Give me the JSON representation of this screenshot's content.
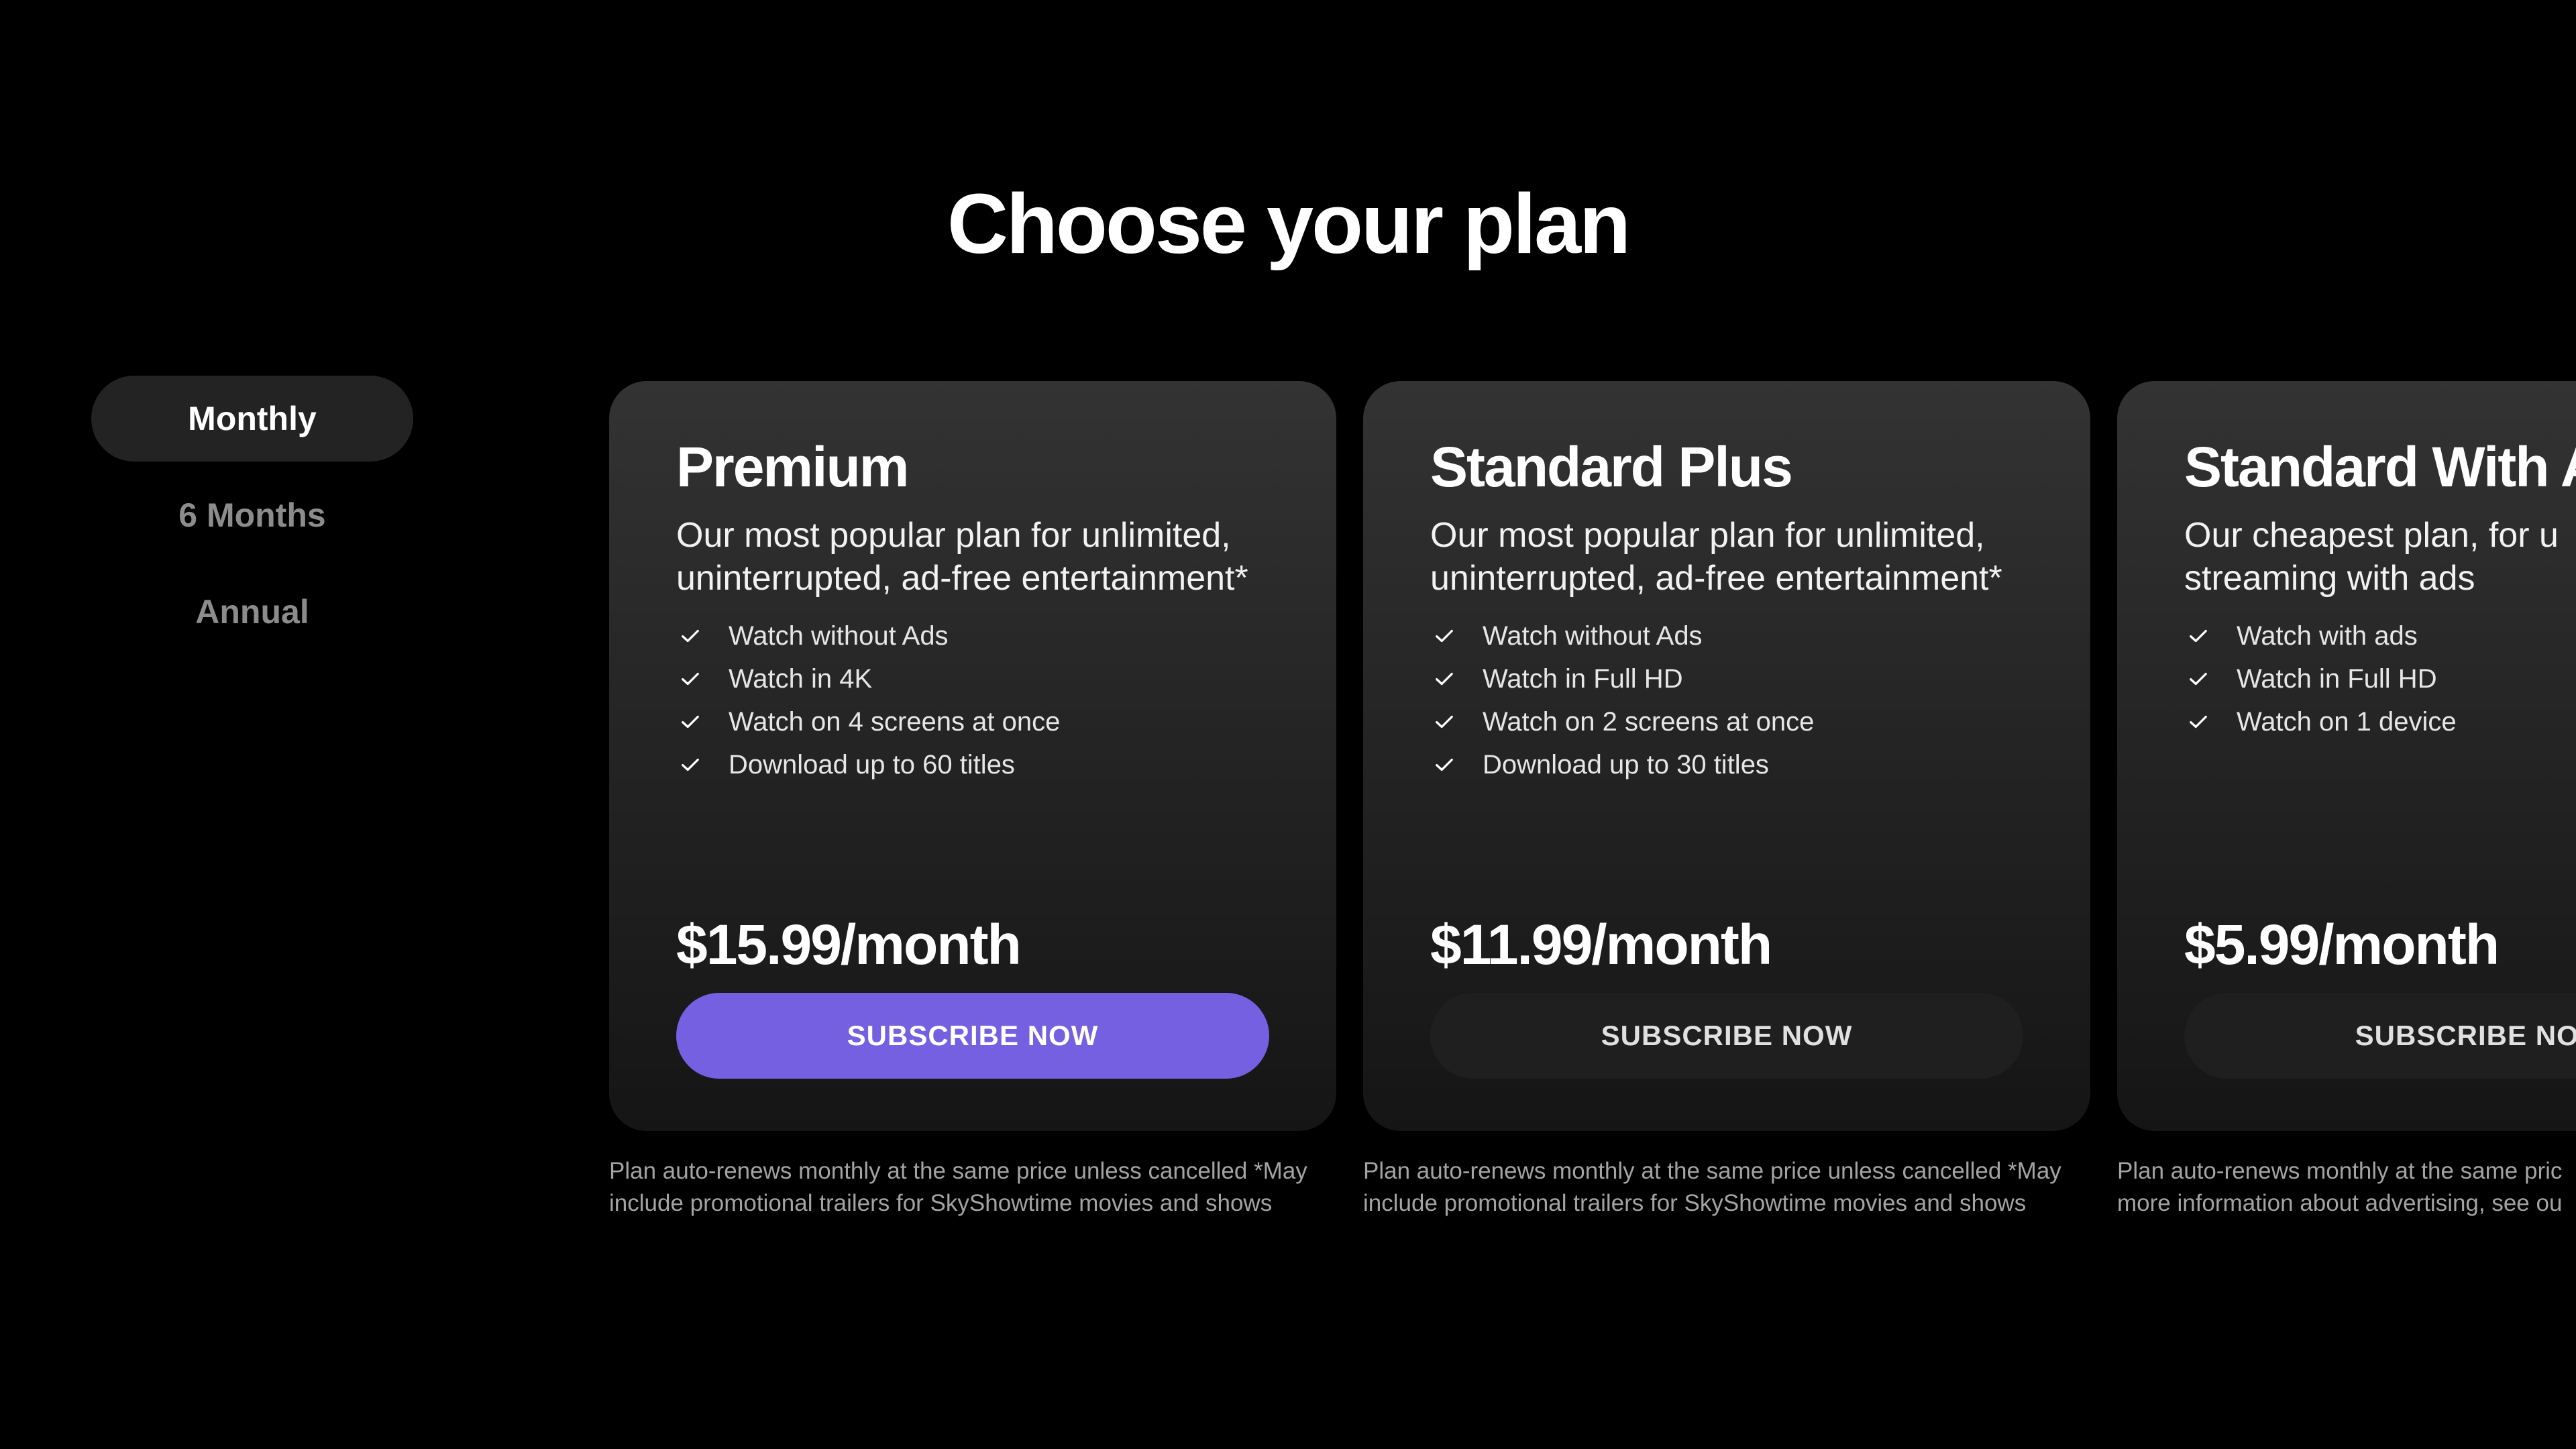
{
  "page": {
    "title": "Choose your plan"
  },
  "periods": {
    "monthly": "Monthly",
    "six_months": "6 Months",
    "annual": "Annual",
    "selected": "Monthly"
  },
  "plans": [
    {
      "name": "Premium",
      "description": "Our most popular plan for unlimited, uninterrupted, ad-free entertainment*",
      "features": [
        "Watch without Ads",
        "Watch in 4K",
        "Watch on 4 screens at once",
        "Download up to 60 titles"
      ],
      "price": "$15.99/month",
      "button_label": "SUBSCRIBE NOW",
      "note": "Plan auto-renews monthly at the same price unless cancelled *May\ninclude promotional trailers for SkyShowtime movies and shows"
    },
    {
      "name": "Standard Plus",
      "description": "Our most popular plan for unlimited, uninterrupted, ad-free entertainment*",
      "features": [
        "Watch without Ads",
        "Watch in Full HD",
        "Watch on 2 screens at once",
        "Download up to 30 titles"
      ],
      "price": "$11.99/month",
      "button_label": "SUBSCRIBE NOW",
      "note": "Plan auto-renews monthly at the same price unless cancelled *May\ninclude promotional trailers for SkyShowtime movies and shows"
    },
    {
      "name": "Standard With A",
      "description": "Our cheapest plan, for u\nstreaming with ads",
      "features": [
        "Watch with ads",
        "Watch in Full HD",
        "Watch on 1 device"
      ],
      "price": "$5.99/month",
      "button_label": "SUBSCRIBE NOW",
      "note": "Plan auto-renews monthly at the same pric\nmore information about advertising, see ou"
    }
  ],
  "colors": {
    "background": "#000000",
    "card": "#2a2a2a",
    "accent": "#7560e2",
    "selected_period": "#232323",
    "muted_text": "#8c8c8c"
  },
  "icons": {
    "feature_bullet": "check-icon"
  }
}
